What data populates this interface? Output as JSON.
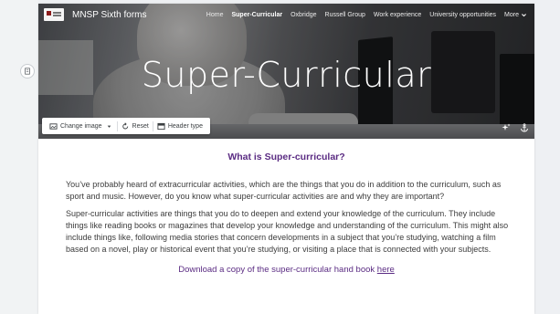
{
  "site": {
    "name": "MNSP Sixth forms"
  },
  "nav": {
    "items": [
      {
        "label": "Home"
      },
      {
        "label": "Super-Curricular",
        "active": true
      },
      {
        "label": "Oxbridge"
      },
      {
        "label": "Russell Group"
      },
      {
        "label": "Work experience"
      },
      {
        "label": "University opportunities"
      }
    ],
    "more_label": "More"
  },
  "hero": {
    "title": "Super-Curricular",
    "tools": {
      "change_image": "Change image",
      "reset": "Reset",
      "header_type": "Header type"
    }
  },
  "content": {
    "heading": "What is Super-curricular?",
    "paragraph1": "You’ve probably heard of extracurricular activities, which are the things that you do in addition to the curriculum, such as sport and music. However, do you know what super-curricular activities are and why they are important?",
    "paragraph2": "Super-curricular activities are things that you do to deepen and extend your knowledge of the curriculum. They include things like reading books or magazines that develop your knowledge and understanding of the curriculum. This might also include things like, following media stories that concern developments in a subject that you’re studying, watching a film based on a novel, play or historical event that you’re studying, or visiting a place that is connected with your subjects.",
    "download_text": "Download a copy of the super-curricular hand book ",
    "download_link": "here"
  },
  "colors": {
    "accent": "#5b2c83",
    "text": "#3c3c3c"
  }
}
